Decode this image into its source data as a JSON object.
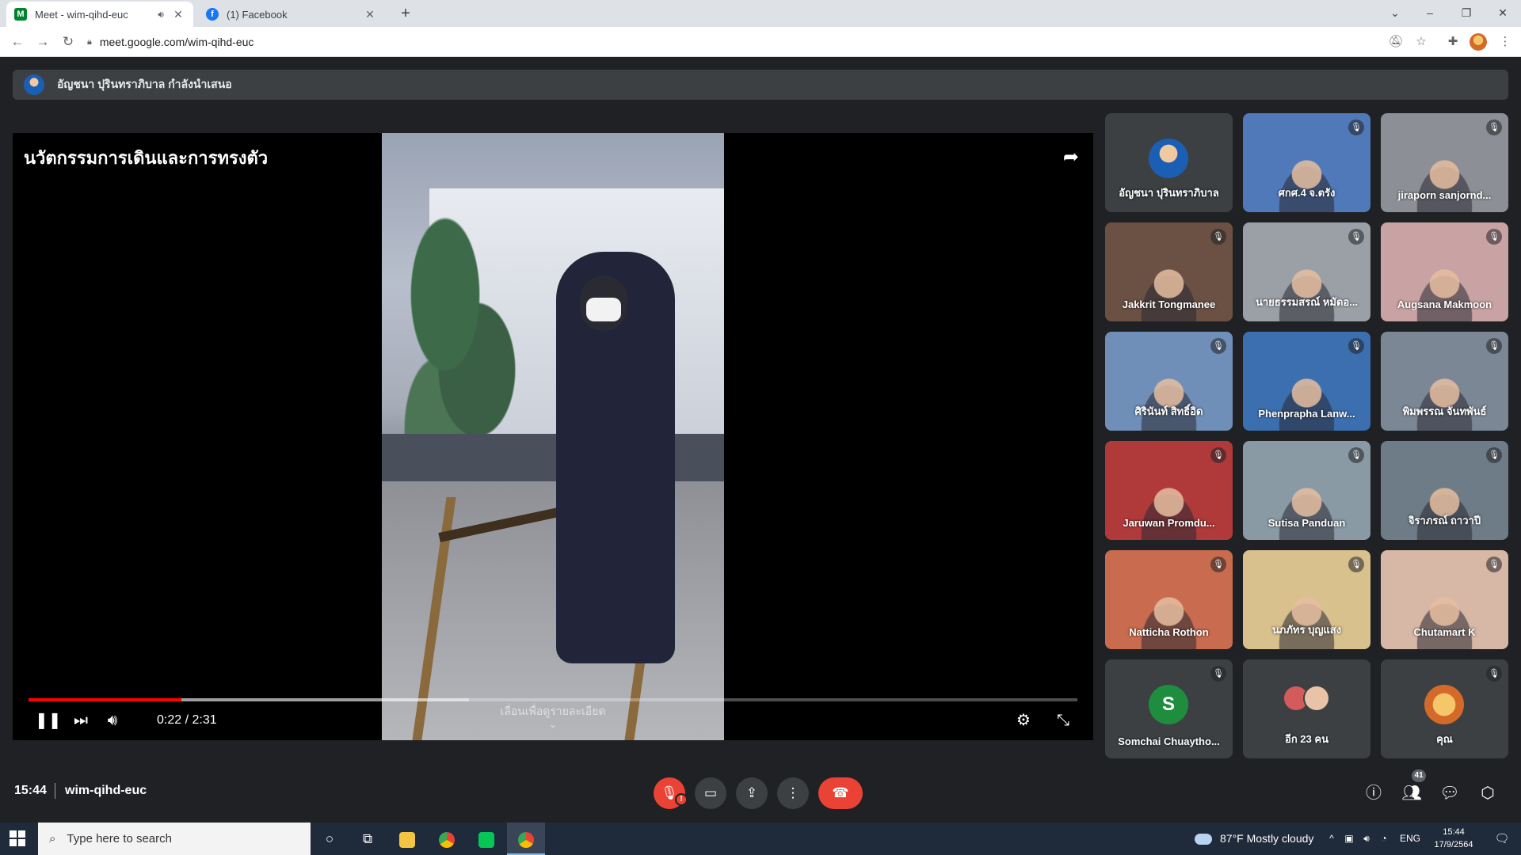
{
  "browser": {
    "tabs": [
      {
        "title": "Meet - wim-qihd-euc",
        "favicon": "meet-icon",
        "audio": true,
        "active": true
      },
      {
        "title": "(1) Facebook",
        "favicon": "facebook-icon",
        "audio": false,
        "active": false
      }
    ],
    "url": "meet.google.com/wim-qihd-euc"
  },
  "meet": {
    "presenting_text": "อัญชนา ปุรินทราภิบาล กำลังนำเสนอ",
    "video": {
      "title": "นวัตกรรมการเดินและการทรงตัว",
      "time_display": "0:22 / 2:31",
      "progress": 0.146,
      "buffered": 0.42,
      "swipe_hint": "เลื่อนเพื่อดูรายละเอียด"
    },
    "participants": [
      {
        "name": "อัญชนา ปุรินทราภิบาล",
        "muted": false,
        "type": "avatar",
        "bg": "#3c4043"
      },
      {
        "name": "ศกศ.4 จ.ตรัง",
        "muted": true,
        "type": "video",
        "bg": "#4f79b8"
      },
      {
        "name": "jiraporn sanjornd...",
        "muted": true,
        "type": "video",
        "bg": "#8c8f95"
      },
      {
        "name": "Jakkrit Tongmanee",
        "muted": true,
        "type": "video",
        "bg": "#6a5143"
      },
      {
        "name": "นายธรรมสรณ์ หมัดอ...",
        "muted": true,
        "type": "video",
        "bg": "#9aa0a6"
      },
      {
        "name": "Augsana Makmoon",
        "muted": true,
        "type": "video",
        "bg": "#c9a3a4"
      },
      {
        "name": "ศิรินันท์ สิทธิ์อิด",
        "muted": true,
        "type": "video",
        "bg": "#6f8fb8"
      },
      {
        "name": "Phenprapha Lanw...",
        "muted": true,
        "type": "video",
        "bg": "#3b6fb0"
      },
      {
        "name": "พิมพรรณ จันทพันธ์",
        "muted": true,
        "type": "video",
        "bg": "#7c8796"
      },
      {
        "name": "Jaruwan Promdu...",
        "muted": true,
        "type": "video",
        "bg": "#b03a3a"
      },
      {
        "name": "Sutisa Panduan",
        "muted": true,
        "type": "video",
        "bg": "#8a9aa5"
      },
      {
        "name": "จิราภรณ์ ถาวาปี",
        "muted": true,
        "type": "video",
        "bg": "#6d7c86"
      },
      {
        "name": "Natticha Rothon",
        "muted": true,
        "type": "video",
        "bg": "#c96b4e"
      },
      {
        "name": "นภภัทร บุญแสง",
        "muted": true,
        "type": "video",
        "bg": "#d9c18e"
      },
      {
        "name": "Chutamart K",
        "muted": true,
        "type": "video",
        "bg": "#d7b7a6"
      },
      {
        "name": "Somchai Chuaytho...",
        "muted": true,
        "type": "letter",
        "letter": "S",
        "bg": "#3c4043",
        "avatar_color": "#1e8e3e"
      },
      {
        "name": "อีก 23 คน",
        "muted": false,
        "type": "more",
        "bg": "#3c4043"
      },
      {
        "name": "คุณ",
        "muted": true,
        "type": "avatar",
        "bg": "#3c4043"
      }
    ],
    "time": "15:44",
    "code": "wim-qihd-euc",
    "people_count": "41"
  },
  "taskbar": {
    "search_placeholder": "Type here to search",
    "weather": "87°F  Mostly cloudy",
    "lang": "ENG",
    "clock_time": "15:44",
    "clock_date": "17/9/2564"
  }
}
